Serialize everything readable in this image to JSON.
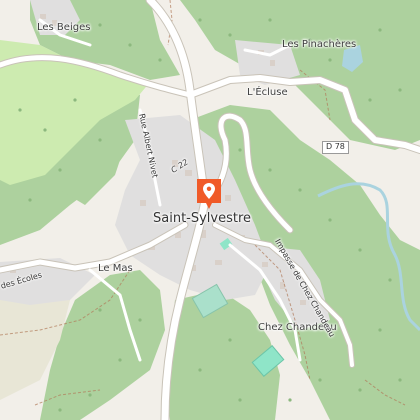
{
  "map": {
    "places": {
      "les_beiges": "Les Beiges",
      "les_pinacheres": "Les Pinachères",
      "lecluse": "L'Écluse",
      "saint_sylvestre": "Saint-Sylvestre",
      "le_mas": "Le Mas",
      "chez_chandeau": "Chez Chandeau",
      "des_ecoles": "des Écoles"
    },
    "streets": {
      "rue_albert_nivet": "Rue Albert Nivet",
      "impasse_chez_chandeau": "Impasse de Chez Chandeau"
    },
    "road_refs": {
      "d78": "D 78",
      "c22": "C 22"
    },
    "marker": {
      "icon": "map-pin-icon",
      "color": "#f05a28"
    },
    "colors": {
      "land": "#f2efe9",
      "forest": "#add19e",
      "meadow": "#cdebb0",
      "residential": "#e0dfdf",
      "water": "#aad3df",
      "road": "#ffffff",
      "path": "#b07a5a"
    }
  }
}
